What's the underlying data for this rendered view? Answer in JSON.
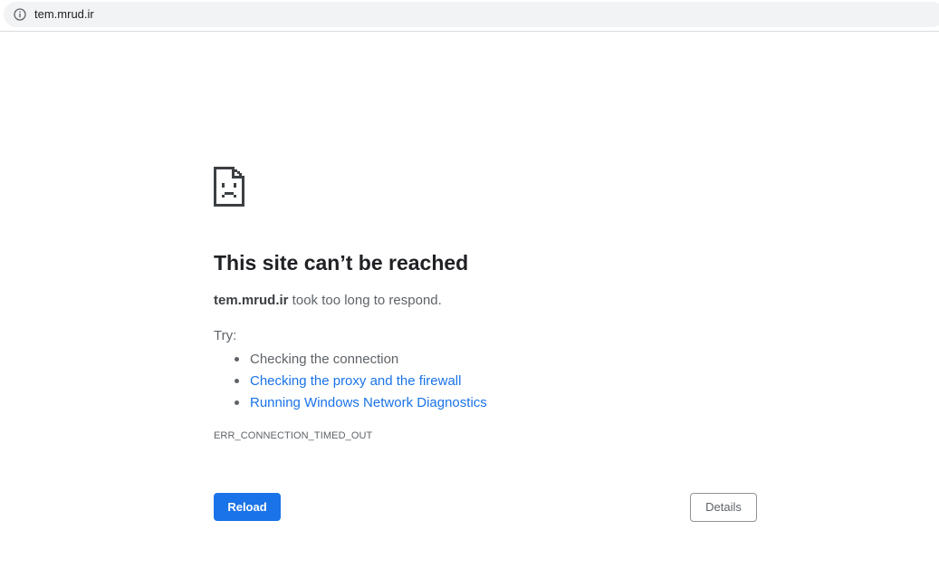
{
  "browser": {
    "url": "tem.mrud.ir",
    "info_icon": "info-icon"
  },
  "error_page": {
    "icon": "sad-document-icon",
    "heading": "This site can’t be reached",
    "host": "tem.mrud.ir",
    "description_rest": " took too long to respond.",
    "try_label": "Try:",
    "suggestions": [
      {
        "label": "Checking the connection",
        "is_link": false
      },
      {
        "label": "Checking the proxy and the firewall",
        "is_link": true
      },
      {
        "label": "Running Windows Network Diagnostics",
        "is_link": true
      }
    ],
    "error_code": "ERR_CONNECTION_TIMED_OUT",
    "reload_label": "Reload",
    "details_label": "Details"
  },
  "colors": {
    "primary": "#1a73e8",
    "text_dark": "#202124",
    "text_secondary": "#5f6368",
    "omnibox_bg": "#f1f3f4"
  }
}
